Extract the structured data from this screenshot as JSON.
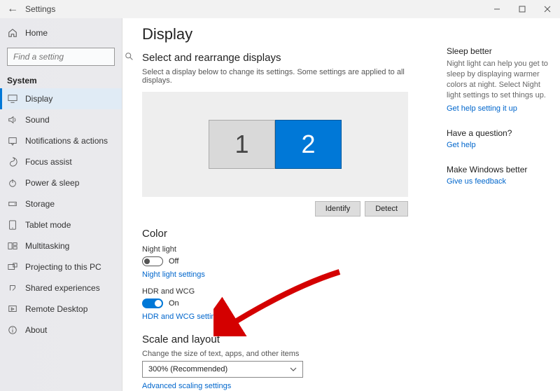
{
  "titlebar": {
    "back_icon": "‹",
    "title": "Settings"
  },
  "sidebar": {
    "home_label": "Home",
    "search_placeholder": "Find a setting",
    "category_label": "System",
    "items": [
      {
        "label": "Display"
      },
      {
        "label": "Sound"
      },
      {
        "label": "Notifications & actions"
      },
      {
        "label": "Focus assist"
      },
      {
        "label": "Power & sleep"
      },
      {
        "label": "Storage"
      },
      {
        "label": "Tablet mode"
      },
      {
        "label": "Multitasking"
      },
      {
        "label": "Projecting to this PC"
      },
      {
        "label": "Shared experiences"
      },
      {
        "label": "Remote Desktop"
      },
      {
        "label": "About"
      }
    ]
  },
  "page": {
    "title": "Display",
    "rearrange_heading": "Select and rearrange displays",
    "rearrange_desc": "Select a display below to change its settings. Some settings are applied to all displays.",
    "monitors": {
      "one": "1",
      "two": "2"
    },
    "identify_label": "Identify",
    "detect_label": "Detect",
    "color_heading": "Color",
    "night_light_label": "Night light",
    "night_light_state": "Off",
    "night_light_settings_link": "Night light settings",
    "hdr_label": "HDR and WCG",
    "hdr_state": "On",
    "hdr_settings_link": "HDR and WCG settings",
    "scale_heading": "Scale and layout",
    "scale_desc": "Change the size of text, apps, and other items",
    "scale_value": "300% (Recommended)",
    "advanced_scaling_link": "Advanced scaling settings"
  },
  "right": {
    "sleep_h": "Sleep better",
    "sleep_body": "Night light can help you get to sleep by displaying warmer colors at night. Select Night light settings to set things up.",
    "sleep_link": "Get help setting it up",
    "question_h": "Have a question?",
    "question_link": "Get help",
    "feedback_h": "Make Windows better",
    "feedback_link": "Give us feedback"
  }
}
